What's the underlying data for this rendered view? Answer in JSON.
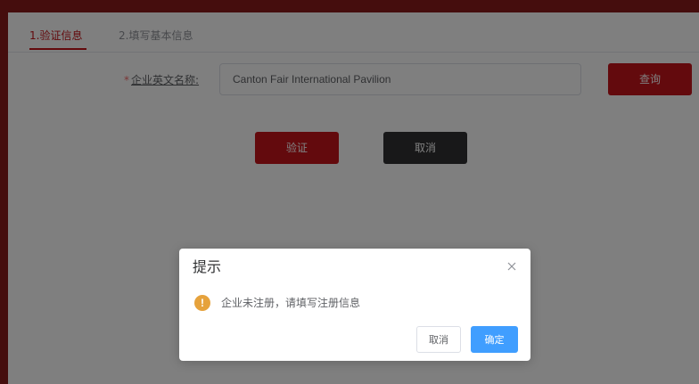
{
  "tabs": [
    {
      "label": "1.验证信息",
      "active": true
    },
    {
      "label": "2.填写基本信息",
      "active": false
    }
  ],
  "form": {
    "required_mark": "*",
    "label": "企业英文名称:",
    "input_value": "Canton Fair International Pavilion",
    "query_button": "查询"
  },
  "actions": {
    "verify_button": "验证",
    "cancel_button": "取消"
  },
  "dialog": {
    "title": "提示",
    "icon": "warning-icon",
    "warn_glyph": "!",
    "message": "企业未注册，请填写注册信息",
    "cancel_button": "取消",
    "confirm_button": "确定"
  },
  "colors": {
    "brand_red": "#c7141b",
    "dark_button": "#303133",
    "primary_blue": "#409eff",
    "warning": "#e6a23c"
  }
}
